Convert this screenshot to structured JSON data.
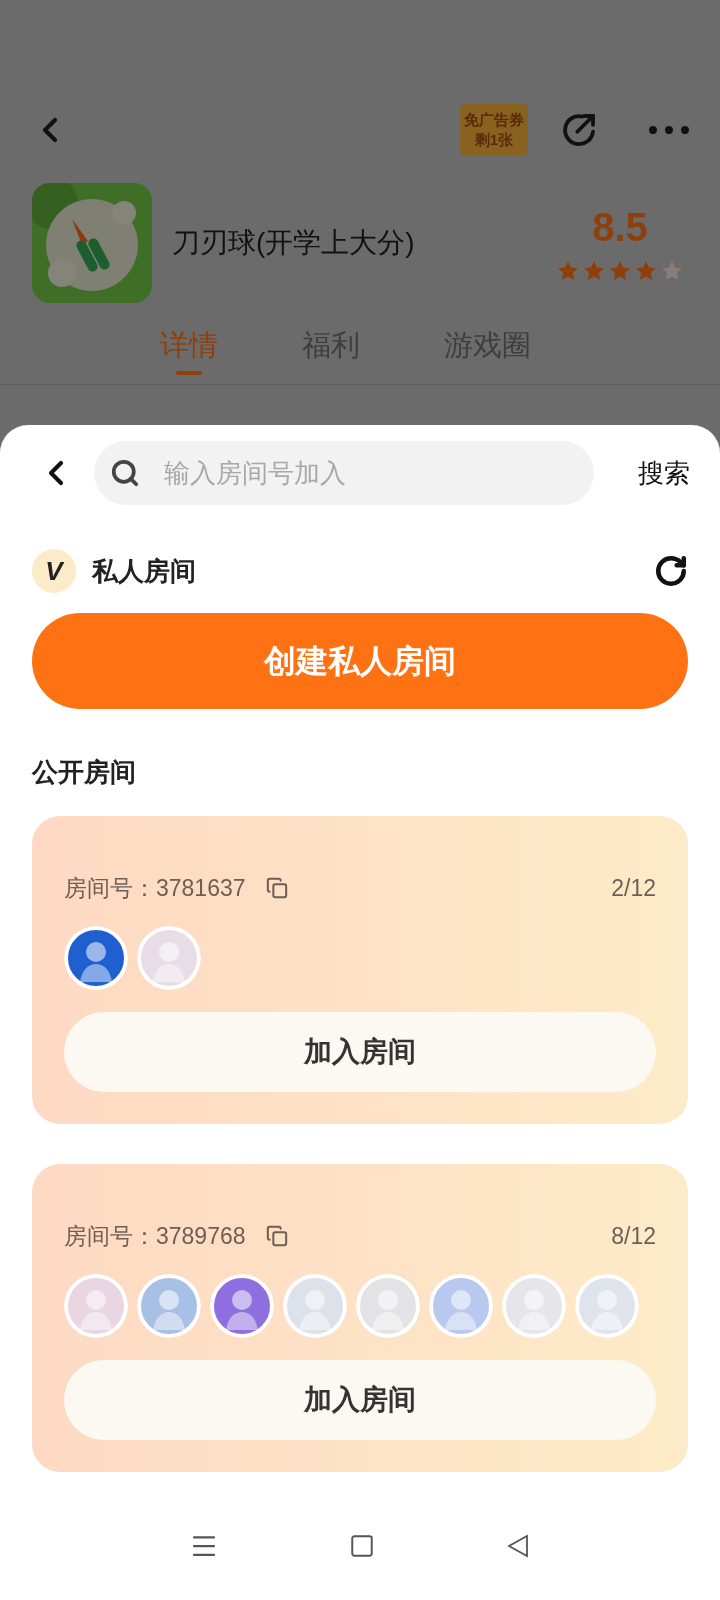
{
  "header": {
    "coupon": {
      "line_1": "免广告券",
      "line_2": "剩1张"
    }
  },
  "game": {
    "title": "刀刃球(开学上大分)",
    "score": "8.5",
    "stars": 4
  },
  "tabs": [
    {
      "label": "详情",
      "selected": true
    },
    {
      "label": "福利",
      "selected": false
    },
    {
      "label": "游戏圈",
      "selected": false
    }
  ],
  "sheet": {
    "search": {
      "placeholder": "输入房间号加入",
      "button": "搜索"
    },
    "private_section": {
      "badge": "V",
      "title": "私人房间",
      "create_button": "创建私人房间"
    },
    "public_section": {
      "title": "公开房间"
    },
    "rooms": [
      {
        "room_label": "房间号：3781637",
        "count": "2/12",
        "join_button": "加入房间"
      },
      {
        "room_label": "房间号：3789768",
        "count": "8/12",
        "join_button": "加入房间"
      }
    ]
  }
}
